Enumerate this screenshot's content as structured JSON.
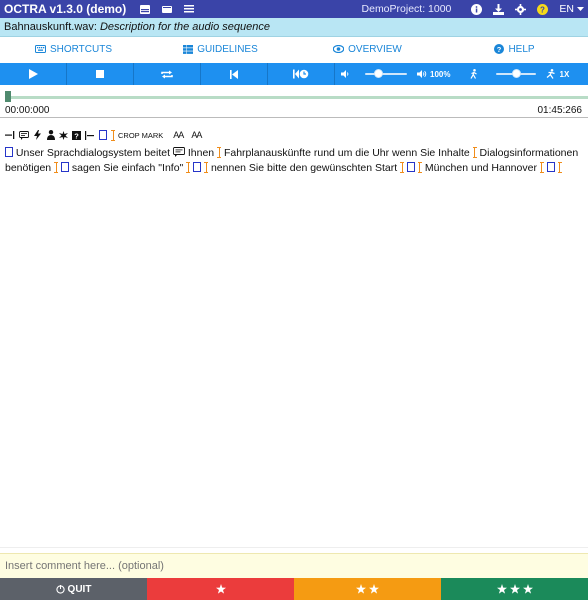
{
  "app": {
    "title": "OCTRA v1.3.0 (demo)",
    "project": "DemoProject: 1000",
    "language": "EN"
  },
  "file": {
    "name": "Bahnauskunft.wav:",
    "description": "Description for the audio sequence"
  },
  "tabs": [
    {
      "label": "SHORTCUTS",
      "icon": "keyboard-icon"
    },
    {
      "label": "GUIDELINES",
      "icon": "grid-icon"
    },
    {
      "label": "OVERVIEW",
      "icon": "eye-icon"
    },
    {
      "label": "HELP",
      "icon": "question-circle-icon"
    }
  ],
  "controls": {
    "volume_label": "100%",
    "speed_label": "1X",
    "volume_level": 0.3,
    "speed_level": 0.5
  },
  "audio": {
    "time_start": "00:00:000",
    "time_end": "01:45:266"
  },
  "toolbar": {
    "crop_mark_label": "CROP MARK",
    "font_bigger": "AA",
    "font_smaller": "AA"
  },
  "transcript": {
    "t1": "Unser Sprachdialogsystem beitet",
    "t2": "Ihnen",
    "t3": "Fahrplanauskünfte rund um die Uhr wenn Sie Inhalte",
    "t4": "Dialogsinformationen benötigen",
    "t5": "sagen Sie einfach \"Info\"",
    "t6": "nennen Sie bitte den gewünschten Start",
    "t7": "München und Hannover"
  },
  "comment": {
    "placeholder": "Insert comment here... (optional)"
  },
  "bottom": {
    "quit_label": "QUIT"
  },
  "colors": {
    "navbar": "#3a44a8",
    "accent": "#1e90f0",
    "quit": "#5c6169",
    "one_star": "#eb3c3c",
    "two_star": "#f59b12",
    "three_star": "#1b8a5a"
  }
}
